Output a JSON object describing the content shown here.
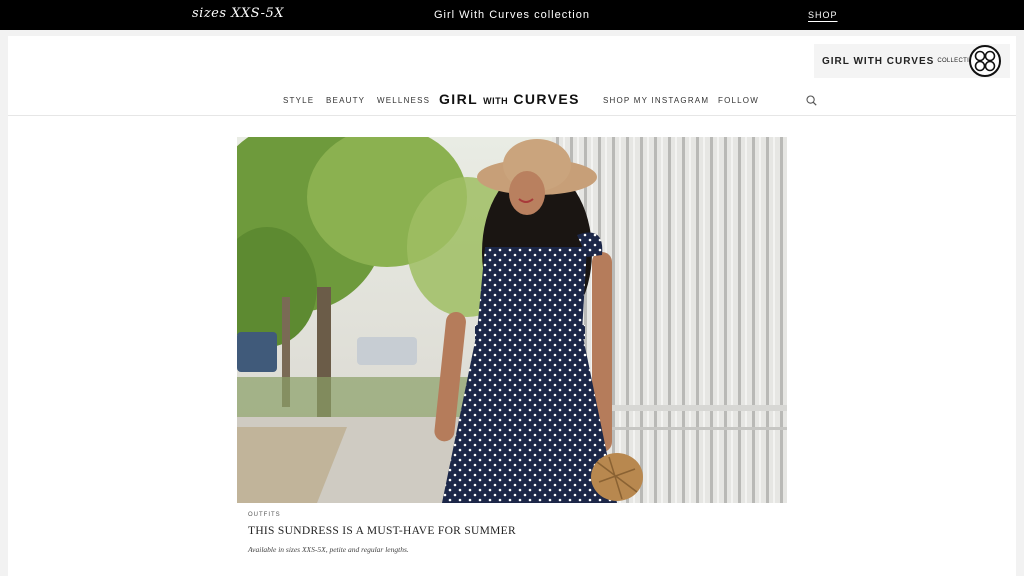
{
  "topbar": {
    "sizes_text": "sizes XXS-5X",
    "collection_text": "Girl With Curves collection",
    "shop_label": "SHOP"
  },
  "badge": {
    "brand_bold": "GIRL WITH CURVES",
    "brand_small": "COLLECTION"
  },
  "nav": {
    "items": [
      "STYLE",
      "BEAUTY",
      "WELLNESS",
      "SHOP MY INSTAGRAM",
      "FOLLOW"
    ],
    "logo_left": "GIRL",
    "logo_mid": "WITH",
    "logo_right": "CURVES",
    "search_icon": "search-icon"
  },
  "post": {
    "category": "OUTFITS",
    "title": "THIS SUNDRESS IS A MUST-HAVE FOR SUMMER",
    "excerpt": "Available in sizes XXS-5X, petite and regular lengths."
  },
  "colors": {
    "topbar_bg": "#000000",
    "page_bg": "#ffffff",
    "dress_navy": "#1c2748"
  }
}
